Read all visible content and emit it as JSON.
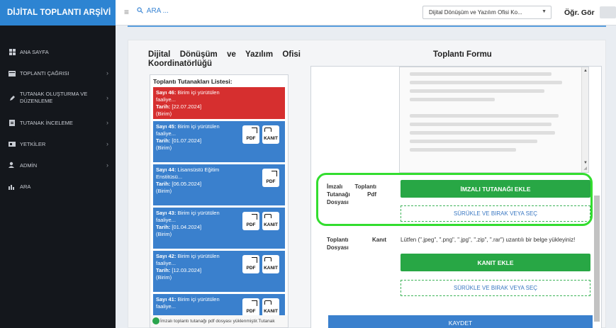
{
  "app": {
    "title": "DİJİTAL TOPLANTI ARŞİVİ"
  },
  "sidebar": {
    "items": [
      {
        "label": "ANA SAYFA",
        "icon": "dashboard-icon",
        "chevron": false
      },
      {
        "label": "TOPLANTI ÇAĞRISI",
        "icon": "calendar-icon",
        "chevron": true
      },
      {
        "label": "TUTANAK OLUŞTURMA VE DÜZENLEME",
        "icon": "pencil-icon",
        "chevron": true
      },
      {
        "label": "TUTANAK İNCELEME",
        "icon": "document-icon",
        "chevron": true
      },
      {
        "label": "YETKİLER",
        "icon": "key-icon",
        "chevron": true
      },
      {
        "label": "ADMİN",
        "icon": "user-gear-icon",
        "chevron": true
      },
      {
        "label": "ARA",
        "icon": "chart-icon",
        "chevron": false
      }
    ]
  },
  "topbar": {
    "search_label": "ARA ...",
    "org_select": "Dijital Dönüşüm ve Yazılım Ofisi Ko...",
    "user": "Öğr. Gör"
  },
  "page": {
    "left_title": "Dijital Dönüşüm ve Yazılım Ofisi Koordinatörlüğü",
    "right_title": "Toplantı Formu"
  },
  "minutes_list": {
    "title": "Toplantı Tutanakları Listesi:",
    "items": [
      {
        "sayi_label": "Sayı 46:",
        "summary": "Birim içi yürütülen faaliye...",
        "date_label": "Tarih:",
        "date": "[22.07.2024]",
        "unit": "(Birim)",
        "color": "#d62f2f",
        "pdf": false,
        "kanit": false
      },
      {
        "sayi_label": "Sayı 45:",
        "summary": "Birim içi yürütülen faaliye...",
        "date_label": "Tarih:",
        "date": "[01.07.2024]",
        "unit": "(Birim)",
        "color": "#3a80cd",
        "pdf": true,
        "kanit": true
      },
      {
        "sayi_label": "Sayı 44:",
        "summary": "Lisansüstü Eğitim Enstitüsü...",
        "date_label": "Tarih:",
        "date": "[06.05.2024]",
        "unit": "(Birim)",
        "color": "#3a80cd",
        "pdf": true,
        "kanit": false
      },
      {
        "sayi_label": "Sayı 43:",
        "summary": "Birim içi yürütülen faaliye...",
        "date_label": "Tarih:",
        "date": "[01.04.2024]",
        "unit": "(Birim)",
        "color": "#3a80cd",
        "pdf": true,
        "kanit": true
      },
      {
        "sayi_label": "Sayı 42:",
        "summary": "Birim içi yürütülen faaliye...",
        "date_label": "Tarih:",
        "date": "[12.03.2024]",
        "unit": "(Birim)",
        "color": "#3a80cd",
        "pdf": true,
        "kanit": true
      },
      {
        "sayi_label": "Sayı 41:",
        "summary": "Birim içi yürütülen faaliye...",
        "date_label": "",
        "date": "",
        "unit": "",
        "color": "#3a80cd",
        "pdf": true,
        "kanit": true
      }
    ],
    "pdf_label": "PDF",
    "kanit_label": "KANIT",
    "footer_note": "İmzalı toplantı tutanağı pdf dosyası yüklenmiştir.Tutanak"
  },
  "form": {
    "signed_pdf_label": "İmzalı Toplantı Tutanağı Pdf Dosyası",
    "signed_pdf_button": "İMZALI TUTANAĞI EKLE",
    "drop_zone_1": "SÜRÜKLE VE BIRAK VEYA SEÇ",
    "evidence_label": "Toplantı Kanıt Dosyası",
    "evidence_hint": "Lütfen (\".jpeg\", \".png\", \".jpg\", \".zip\", \".rar\") uzantılı bir belge yükleyiniz!",
    "evidence_button": "KANIT EKLE",
    "drop_zone_2": "SÜRÜKLE VE BIRAK VEYA SEÇ",
    "save_button": "KAYDET"
  },
  "colors": {
    "brand": "#2d84d2",
    "sidebar_bg": "#14171c",
    "green": "#28a745",
    "red_card": "#d62f2f",
    "blue_card": "#3a80cd",
    "highlight": "#33dd2f"
  }
}
